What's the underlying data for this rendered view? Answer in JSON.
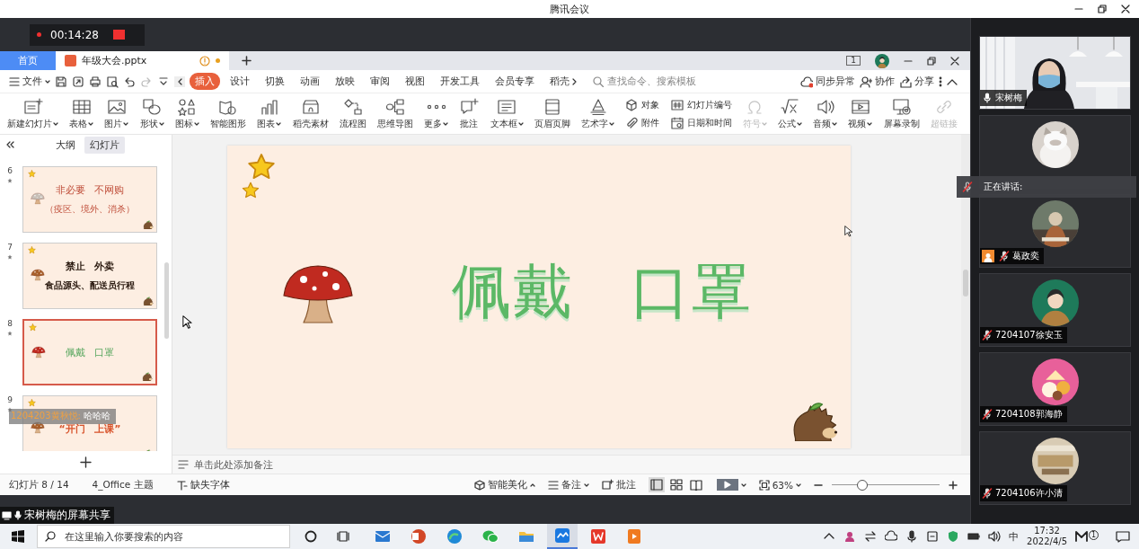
{
  "window": {
    "title": "腾讯会议"
  },
  "recording": {
    "timer": "00:14:28"
  },
  "wps": {
    "tabs": [
      {
        "label": "首页",
        "selected": false,
        "modified": false
      },
      {
        "label": "年级大会.pptx",
        "selected": true,
        "modified": true
      }
    ],
    "screen_count": "1",
    "menu": {
      "file": "文件",
      "tabs": [
        {
          "label": "插入",
          "selected": true
        },
        {
          "label": "设计",
          "selected": false
        },
        {
          "label": "切换",
          "selected": false
        },
        {
          "label": "动画",
          "selected": false
        },
        {
          "label": "放映",
          "selected": false
        },
        {
          "label": "审阅",
          "selected": false
        },
        {
          "label": "视图",
          "selected": false
        },
        {
          "label": "开发工具",
          "selected": false
        },
        {
          "label": "会员专享",
          "selected": false
        },
        {
          "label": "稻壳",
          "selected": false
        }
      ],
      "search": {
        "placeholder": "查找命令、搜索模板"
      },
      "actions": [
        "同步异常",
        "协作",
        "分享"
      ]
    },
    "ribbon": [
      {
        "kind": "big",
        "label": "新建幻灯片",
        "dropdown": true,
        "disabled": false
      },
      {
        "kind": "big",
        "label": "表格",
        "dropdown": true,
        "disabled": false
      },
      {
        "kind": "big",
        "label": "图片",
        "dropdown": true,
        "disabled": false
      },
      {
        "kind": "big",
        "label": "形状",
        "dropdown": true,
        "disabled": false
      },
      {
        "kind": "big",
        "label": "图标",
        "dropdown": true,
        "disabled": false
      },
      {
        "kind": "big",
        "label": "智能图形",
        "dropdown": false,
        "disabled": false
      },
      {
        "kind": "big",
        "label": "图表",
        "dropdown": true,
        "disabled": false
      },
      {
        "kind": "big",
        "label": "稻壳素材",
        "dropdown": false,
        "disabled": false
      },
      {
        "kind": "big",
        "label": "流程图",
        "dropdown": false,
        "disabled": false
      },
      {
        "kind": "big",
        "label": "思维导图",
        "dropdown": false,
        "disabled": false
      },
      {
        "kind": "big",
        "label": "更多",
        "dropdown": true,
        "disabled": false
      },
      {
        "kind": "big",
        "label": "批注",
        "dropdown": false,
        "disabled": false
      },
      {
        "kind": "big",
        "label": "文本框",
        "dropdown": true,
        "disabled": false
      },
      {
        "kind": "big",
        "label": "页眉页脚",
        "dropdown": false,
        "disabled": false
      },
      {
        "kind": "big",
        "label": "艺术字",
        "dropdown": true,
        "disabled": false
      },
      {
        "kind": "stack",
        "items": [
          {
            "label": "对象"
          },
          {
            "label": "附件"
          }
        ]
      },
      {
        "kind": "stack",
        "items": [
          {
            "label": "幻灯片编号"
          },
          {
            "label": "日期和时间"
          }
        ]
      },
      {
        "kind": "big",
        "label": "符号",
        "dropdown": true,
        "disabled": true
      },
      {
        "kind": "big",
        "label": "公式",
        "dropdown": true,
        "disabled": false
      },
      {
        "kind": "big",
        "label": "音频",
        "dropdown": true,
        "disabled": false
      },
      {
        "kind": "big",
        "label": "视频",
        "dropdown": true,
        "disabled": false
      },
      {
        "kind": "big",
        "label": "屏幕录制",
        "dropdown": false,
        "disabled": false
      },
      {
        "kind": "big",
        "label": "超链接",
        "dropdown": false,
        "disabled": true
      }
    ],
    "panel": {
      "tabs": [
        {
          "label": "大纲",
          "selected": false
        },
        {
          "label": "幻灯片",
          "selected": true
        }
      ],
      "slides": [
        {
          "number": "6",
          "selected": false,
          "bold": false,
          "lines": [
            "非必要 不网购",
            "（疫区、境外、消杀）"
          ]
        },
        {
          "number": "7",
          "selected": false,
          "bold": true,
          "lines": [
            "禁止 外卖",
            "食品源头、配送员行程"
          ]
        },
        {
          "number": "8",
          "selected": true,
          "bold": false,
          "lines": [
            "佩戴 口罩"
          ]
        },
        {
          "number": "9",
          "selected": false,
          "bold": true,
          "lines": [
            "“开门 上课”"
          ]
        }
      ]
    },
    "chat": {
      "sender": "1204203黄秋悦:",
      "message": "哈哈哈"
    },
    "slide": {
      "title": "佩戴 口罩"
    },
    "notes": {
      "placeholder": "单击此处添加备注"
    },
    "status": {
      "slide": "幻灯片 8 / 14",
      "theme": "4_Office 主题",
      "font": "缺失字体",
      "beautify": "智能美化",
      "notes": "备注",
      "comments": "批注",
      "views": [
        {
          "selected": true
        },
        {
          "selected": false
        },
        {
          "selected": false
        }
      ],
      "zoom": "63%",
      "level": 0.28
    }
  },
  "share_label": "宋树梅的屏幕共享",
  "participants": [
    {
      "kind": "video",
      "name": "宋树梅",
      "muted": false,
      "host": false
    },
    {
      "kind": "avatar"
    },
    {
      "kind": "avatar",
      "name": "葛政奕",
      "muted": true,
      "host": true
    },
    {
      "kind": "avatar",
      "name": "7204107徐安玉",
      "muted": true,
      "host": false
    },
    {
      "kind": "avatar",
      "name": "7204108郭海静",
      "muted": true,
      "host": false
    },
    {
      "kind": "avatar",
      "name": "7204106许小清",
      "muted": true,
      "host": false
    }
  ],
  "speaking": {
    "label": "正在讲话:"
  },
  "taskbar": {
    "search": {
      "placeholder": "在这里输入你要搜索的内容"
    },
    "apps": [
      {
        "selected": false
      },
      {
        "selected": false
      },
      {
        "selected": false
      },
      {
        "selected": false
      },
      {
        "selected": false
      },
      {
        "selected": true
      },
      {
        "selected": false
      },
      {
        "selected": false
      }
    ],
    "badge": "1",
    "ime": "中",
    "time": "17:32",
    "date": "2022/4/5"
  }
}
